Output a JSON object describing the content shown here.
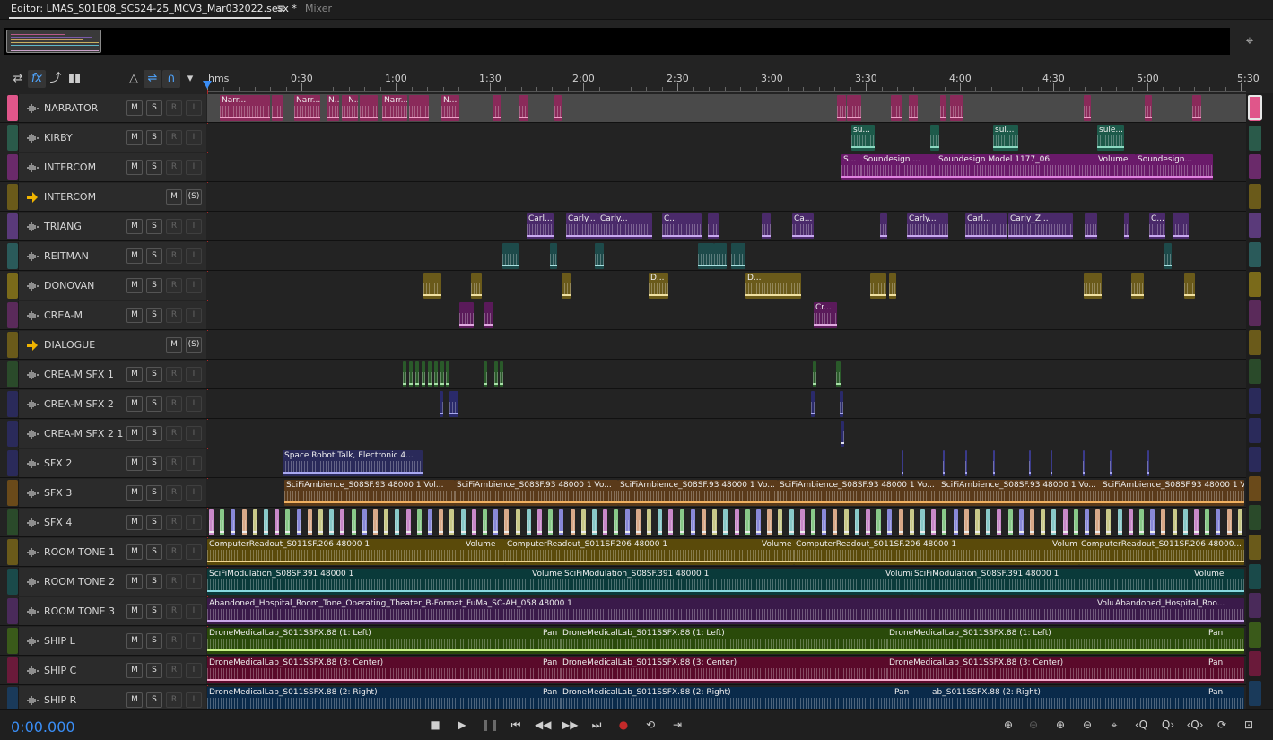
{
  "tabs": {
    "editor": "Editor: LMAS_S01E08_SCS24-25_MCV3_Mar032022.sesx *",
    "menu": "≡",
    "mixer": "Mixer"
  },
  "ruler": {
    "labels": [
      "hms",
      "0:30",
      "1:00",
      "1:30",
      "2:00",
      "2:30",
      "3:00",
      "3:30",
      "4:00",
      "4:30",
      "5:00",
      "5:30"
    ]
  },
  "toolbar": {
    "icons": [
      "switch-icon",
      "fx-icon",
      "send-icon",
      "meter-icon",
      "metronome-icon",
      "loop-icon",
      "snap-icon",
      "marker-icon"
    ],
    "fx_label": "fx"
  },
  "buttons": {
    "m": "M",
    "s": "S",
    "r": "R",
    "i": "I",
    "bus_s": "(S)"
  },
  "colors": {
    "narrator": "#e0568a",
    "kirby": "#2a5a4a",
    "intercom": "#6a2a6a",
    "bus": "#6a5a1a",
    "triang": "#5a3a7a",
    "reitman": "#2a5a5a",
    "donovan": "#7a6a1a",
    "crea": "#5a2a5a",
    "sfx1": "#2a4a2a",
    "sfx2": "#2a2a5a",
    "sfx3": "#6a4a1a",
    "rt1": "#6a5a1a",
    "rt2": "#1a4a4a",
    "rt3": "#4a2a5a",
    "shipl": "#3a5a1a",
    "shipc": "#6a1a3a",
    "shipr": "#1a3a5a"
  },
  "tracks": [
    {
      "name": "NARRATOR",
      "type": "audio"
    },
    {
      "name": "KIRBY",
      "type": "audio"
    },
    {
      "name": "INTERCOM",
      "type": "audio"
    },
    {
      "name": "INTERCOM",
      "type": "bus"
    },
    {
      "name": "TRIANG",
      "type": "audio"
    },
    {
      "name": "REITMAN",
      "type": "audio"
    },
    {
      "name": "DONOVAN",
      "type": "audio"
    },
    {
      "name": "CREA-M",
      "type": "audio"
    },
    {
      "name": "DIALOGUE",
      "type": "bus"
    },
    {
      "name": "CREA-M SFX 1",
      "type": "audio"
    },
    {
      "name": "CREA-M SFX 2",
      "type": "audio"
    },
    {
      "name": "CREA-M SFX 2 1",
      "type": "audio"
    },
    {
      "name": "SFX 2",
      "type": "audio"
    },
    {
      "name": "SFX 3",
      "type": "audio"
    },
    {
      "name": "SFX 4",
      "type": "audio"
    },
    {
      "name": "ROOM TONE 1",
      "type": "audio"
    },
    {
      "name": "ROOM TONE 2",
      "type": "audio"
    },
    {
      "name": "ROOM TONE 3",
      "type": "audio"
    },
    {
      "name": "SHIP L",
      "type": "audio"
    },
    {
      "name": "SHIP C",
      "type": "audio"
    },
    {
      "name": "SHIP R",
      "type": "audio"
    }
  ],
  "clips": {
    "narrator": [
      "Narr...",
      "Narr...",
      "N...",
      "N...",
      "Narr...",
      "N..."
    ],
    "kirby": [
      "su...",
      "sul...",
      "sule..."
    ],
    "intercom": [
      "S...",
      "Soundesign ...",
      "Soundesign Model 1177_06",
      "Volume",
      "Soundesign..."
    ],
    "triang": [
      "Carl...",
      "Carly...",
      "Carly...",
      "C...",
      "Ca...",
      "Carly...",
      "Carl...",
      "Carly_Z...",
      "C..."
    ],
    "reitman": [
      "_",
      "_",
      "_"
    ],
    "donovan": [
      "D...",
      "D...",
      "_",
      "_"
    ],
    "crea": [
      "Cr..."
    ],
    "sfx2": [
      "Space Robot Talk, Electronic 4..."
    ],
    "sfx3": [
      "SciFiAmbience_S08SF.93 48000 1 Vol...",
      "SciFiAmbience_S08SF.93 48000 1 Vo...",
      "SciFiAmbience_S08SF.93 48000 1 Vo...",
      "SciFiAmbience_S08SF.93 48000 1 Vo...",
      "SciFiAmbience_S08SF.93 48000 1 Vo...",
      "SciFiAmbience_S08SF.93 48000 1 Volume",
      "SciFiAmbience_S08SF.93 48000..."
    ],
    "rt1": [
      "ComputerReadout_S011SF.206 48000 1",
      "Volume",
      "ComputerReadout_S011SF.206 48000 1",
      "Volume",
      "ComputerReadout_S011SF.206 48000 1",
      "Volum",
      "ComputerReadout_S011SF.206 48000..."
    ],
    "rt2": [
      "SciFiModulation_S08SF.391 48000 1",
      "Volume",
      "SciFiModulation_S08SF.391 48000 1",
      "Volume",
      "SciFiModulation_S08SF.391 48000 1",
      "Volume"
    ],
    "rt3": [
      "Abandoned_Hospital_Room_Tone_Operating_Theater_B-Format_FuMa_SC-AH_058 48000 1",
      "Volu",
      "Abandoned_Hospital_Roo..."
    ],
    "shipl": [
      "DroneMedicalLab_S011SSFX.88 (1: Left)",
      "Pan",
      "DroneMedicalLab_S011SSFX.88 (1: Left)",
      "DroneMedicalLab_S011SSFX.88 (1: Left)",
      "Pan"
    ],
    "shipc": [
      "DroneMedicalLab_S011SSFX.88 (3: Center)",
      "Pan",
      "DroneMedicalLab_S011SSFX.88 (3: Center)",
      "DroneMedicalLab_S011SSFX.88 (3: Center)",
      "Pan"
    ],
    "shipr": [
      "DroneMedicalLab_S011SSFX.88 (2: Right)",
      "Pan",
      "DroneMedicalLab_S011SSFX.88 (2: Right)",
      "Pan",
      "ab_S011SSFX.88 (2: Right)",
      "Pan"
    ]
  },
  "transport": {
    "timecode": "0:00.000",
    "buttons": [
      "stop-icon",
      "play-icon",
      "pause-icon",
      "to-start-icon",
      "rewind-icon",
      "fast-forward-icon",
      "to-end-icon",
      "record-icon",
      "loop-icon",
      "skip-selection-icon"
    ],
    "zoom_buttons": [
      "zoom-in-amplitude-icon",
      "zoom-out-amplitude-icon",
      "zoom-in-time-icon",
      "zoom-out-time-icon",
      "zoom-selection-icon",
      "zoom-in-point-icon",
      "zoom-out-point-icon",
      "zoom-out-full-icon",
      "zoom-tracks-icon",
      "zoom-reset-icon"
    ]
  }
}
